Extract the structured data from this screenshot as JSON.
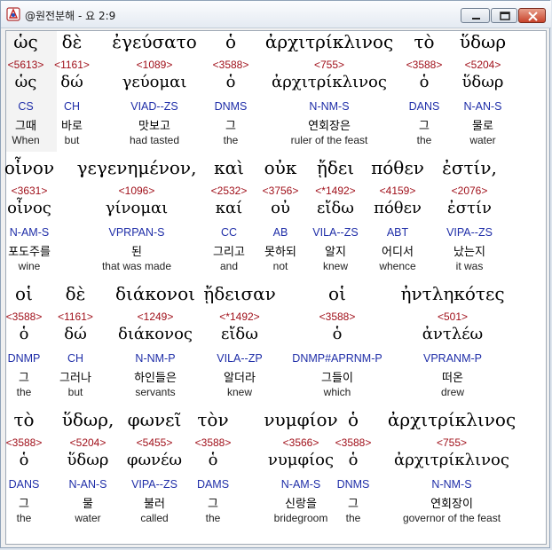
{
  "window": {
    "title": "@원전분해 - 요 2:9"
  },
  "verse_rows": [
    {
      "words": [
        {
          "greek": "ὡς",
          "strong": "<5613>",
          "lemma": "ὡς",
          "parse": "CS",
          "korean": "그때",
          "english": "When"
        },
        {
          "greek": "δὲ",
          "strong": "<1161>",
          "lemma": "δώ",
          "parse": "CH",
          "korean": "바로",
          "english": "but"
        },
        {
          "greek": "ἐγεύσατο",
          "strong": "<1089>",
          "lemma": "γεύομαι",
          "parse": "VIAD--ZS",
          "korean": "맛보고",
          "english": "had tasted"
        },
        {
          "greek": "ὁ",
          "strong": "<3588>",
          "lemma": "ὁ",
          "parse": "DNMS",
          "korean": "그",
          "english": "the"
        },
        {
          "greek": "ἀρχιτρίκλινος",
          "strong": "<755>",
          "lemma": "ἀρχιτρίκλινος",
          "parse": "N-NM-S",
          "korean": "연회장은",
          "english": "ruler of the feast"
        },
        {
          "greek": "τὸ",
          "strong": "<3588>",
          "lemma": "ὁ",
          "parse": "DANS",
          "korean": "그",
          "english": "the"
        },
        {
          "greek": "ὕδωρ",
          "strong": "<5204>",
          "lemma": "ὕδωρ",
          "parse": "N-AN-S",
          "korean": "물로",
          "english": "water"
        }
      ]
    },
    {
      "words": [
        {
          "greek": "οἶνον",
          "strong": "<3631>",
          "lemma": "οἶνος",
          "parse": "N-AM-S",
          "korean": "포도주를",
          "english": "wine"
        },
        {
          "greek": "γεγενημένον,",
          "strong": "<1096>",
          "lemma": "γίνομαι",
          "parse": "VPRPAN-S",
          "korean": "된",
          "english": "that was made"
        },
        {
          "greek": "καὶ",
          "strong": "<2532>",
          "lemma": "καί",
          "parse": "CC",
          "korean": "그리고",
          "english": "and"
        },
        {
          "greek": "οὐκ",
          "strong": "<3756>",
          "lemma": "οὐ",
          "parse": "AB",
          "korean": "못하되",
          "english": "not"
        },
        {
          "greek": "ᾔδει",
          "strong": "<*1492>",
          "lemma": "εἴδω",
          "parse": "VILA--ZS",
          "korean": "알지",
          "english": "knew"
        },
        {
          "greek": "πόθεν",
          "strong": "<4159>",
          "lemma": "πόθεν",
          "parse": "ABT",
          "korean": "어디서",
          "english": "whence"
        },
        {
          "greek": "ἐστίν,",
          "strong": "<2076>",
          "lemma": "ἐστίν",
          "parse": "VIPA--ZS",
          "korean": "났는지",
          "english": "it was"
        }
      ]
    },
    {
      "words": [
        {
          "greek": "οἱ",
          "strong": "<3588>",
          "lemma": "ὁ",
          "parse": "DNMP",
          "korean": "그",
          "english": "the"
        },
        {
          "greek": "δὲ",
          "strong": "<1161>",
          "lemma": "δώ",
          "parse": "CH",
          "korean": "그러나",
          "english": "but"
        },
        {
          "greek": "διάκονοι",
          "strong": "<1249>",
          "lemma": "διάκονος",
          "parse": "N-NM-P",
          "korean": "하인들은",
          "english": "servants"
        },
        {
          "greek": "ᾔδεισαν",
          "strong": "<*1492>",
          "lemma": "εἴδω",
          "parse": "VILA--ZP",
          "korean": "알더라",
          "english": "knew"
        },
        {
          "greek": "οἱ",
          "strong": "<3588>",
          "lemma": "ὁ",
          "parse": "DNMP#APRNM-P",
          "korean": "그들이",
          "english": "which"
        },
        {
          "greek": "ἠντληκότες",
          "strong": "<501>",
          "lemma": "ἀντλέω",
          "parse": "VPRANM-P",
          "korean": "떠온",
          "english": "drew"
        }
      ]
    },
    {
      "words": [
        {
          "greek": "τὸ",
          "strong": "<3588>",
          "lemma": "ὁ",
          "parse": "DANS",
          "korean": "그",
          "english": "the"
        },
        {
          "greek": "ὕδωρ,",
          "strong": "<5204>",
          "lemma": "ὕδωρ",
          "parse": "N-AN-S",
          "korean": "물",
          "english": "water"
        },
        {
          "greek": "φωνεῖ",
          "strong": "<5455>",
          "lemma": "φωνέω",
          "parse": "VIPA--ZS",
          "korean": "불러",
          "english": "called"
        },
        {
          "greek": "τὸν",
          "strong": "<3588>",
          "lemma": "ὁ",
          "parse": "DAMS",
          "korean": "그",
          "english": "the"
        },
        {
          "greek": "νυμφίον",
          "strong": "<3566>",
          "lemma": "νυμφίος",
          "parse": "N-AM-S",
          "korean": "신랑을",
          "english": "bridegroom"
        },
        {
          "greek": "ὁ",
          "strong": "<3588>",
          "lemma": "ὁ",
          "parse": "DNMS",
          "korean": "그",
          "english": "the"
        },
        {
          "greek": "ἀρχιτρίκλινος",
          "strong": "<755>",
          "lemma": "ἀρχιτρίκλινος",
          "parse": "N-NM-S",
          "korean": "연회장이",
          "english": "governor of the feast"
        }
      ]
    }
  ],
  "colors": {
    "strong": "#a0101a",
    "parse": "#1f2ea8",
    "text": "#000000",
    "english": "#222222"
  }
}
